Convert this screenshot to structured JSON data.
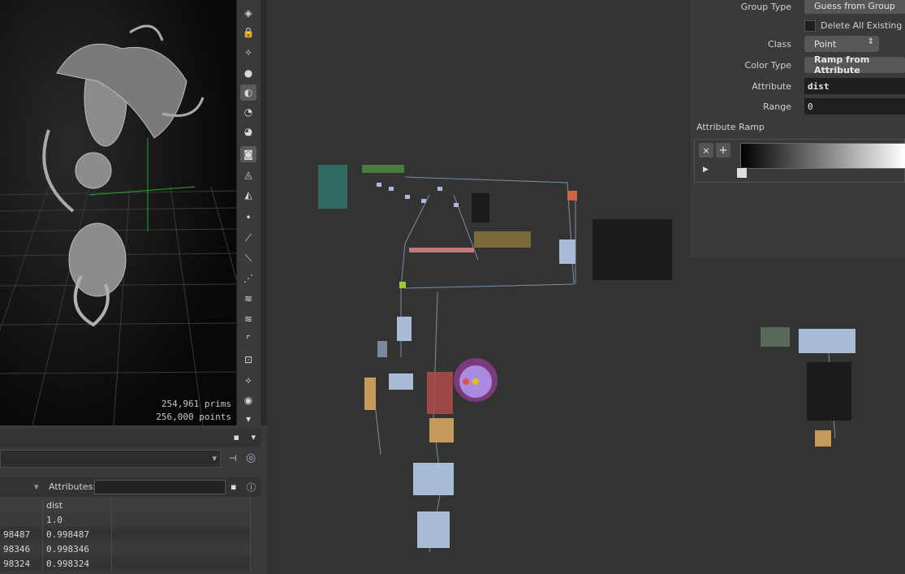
{
  "viewport": {
    "prims": "254,961  prims",
    "points": "256,000 points"
  },
  "spreadsheet": {
    "attributes_label": "Attributes:",
    "column": "dist",
    "rows": [
      {
        "left": "",
        "dist": "1.0"
      },
      {
        "left": "98487",
        "dist": "0.998487"
      },
      {
        "left": "98346",
        "dist": "0.998346"
      },
      {
        "left": "98324",
        "dist": "0.998324"
      }
    ]
  },
  "params": {
    "group_type_label": "Group Type",
    "group_type_value": "Guess from Group",
    "delete_label": "Delete All Existing Co",
    "class_label": "Class",
    "class_value": "Point",
    "color_type_label": "Color Type",
    "color_type_value": "Ramp from Attribute",
    "attribute_label": "Attribute",
    "attribute_value": "dist",
    "range_label": "Range",
    "range_value": "0",
    "ramp_label": "Attribute Ramp"
  },
  "icons": [
    "select-icon",
    "lock-icon",
    "light-icon",
    "sphere-icon",
    "bulb-icon",
    "bulb-icon",
    "bulb-icon",
    "camera-icon",
    "snap-icon",
    "snap-icon",
    "point-icon",
    "brush-icon",
    "pin-icon",
    "grid-icon",
    "grid-icon",
    "curve-icon",
    "box-icon",
    "vector-icon",
    "disc-icon"
  ],
  "colors": {
    "accent": "#8a3a8a",
    "panel": "#3a3a3a",
    "field": "#1f1f1f"
  }
}
